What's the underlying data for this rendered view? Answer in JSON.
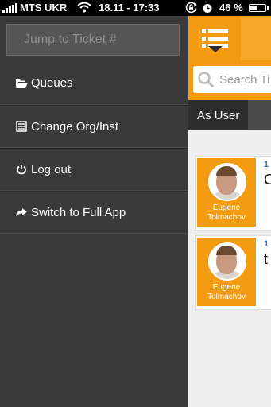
{
  "status_bar": {
    "carrier": "MTS UKR",
    "time": "18.11 - 17:33",
    "battery_percent": "46 %",
    "battery_level": 0.46,
    "icons": [
      "signal-icon",
      "wifi-icon",
      "orientation-lock-icon",
      "alarm-icon",
      "battery-icon"
    ]
  },
  "sidebar": {
    "jump_placeholder": "Jump to Ticket #",
    "items": [
      {
        "label": "Queues",
        "icon": "folder-open-icon"
      },
      {
        "label": "Change Org/Inst",
        "icon": "list-icon"
      },
      {
        "label": "Log out",
        "icon": "power-icon"
      },
      {
        "label": "Switch to Full App",
        "icon": "share-arrow-icon"
      }
    ]
  },
  "main": {
    "menu_icon": "hamburger-list-icon",
    "search_placeholder": "Search Ti",
    "tab_label": "As User",
    "tickets": [
      {
        "num": "1",
        "title": "C",
        "user_name": "Eugene Tolmachov"
      },
      {
        "num": "1",
        "title": "t",
        "user_name": "Eugene Tolmachov"
      }
    ]
  },
  "colors": {
    "accent_orange": "#f39c12",
    "sidebar_bg": "#3a3a3a",
    "tab_dark": "#2e2e2e"
  }
}
